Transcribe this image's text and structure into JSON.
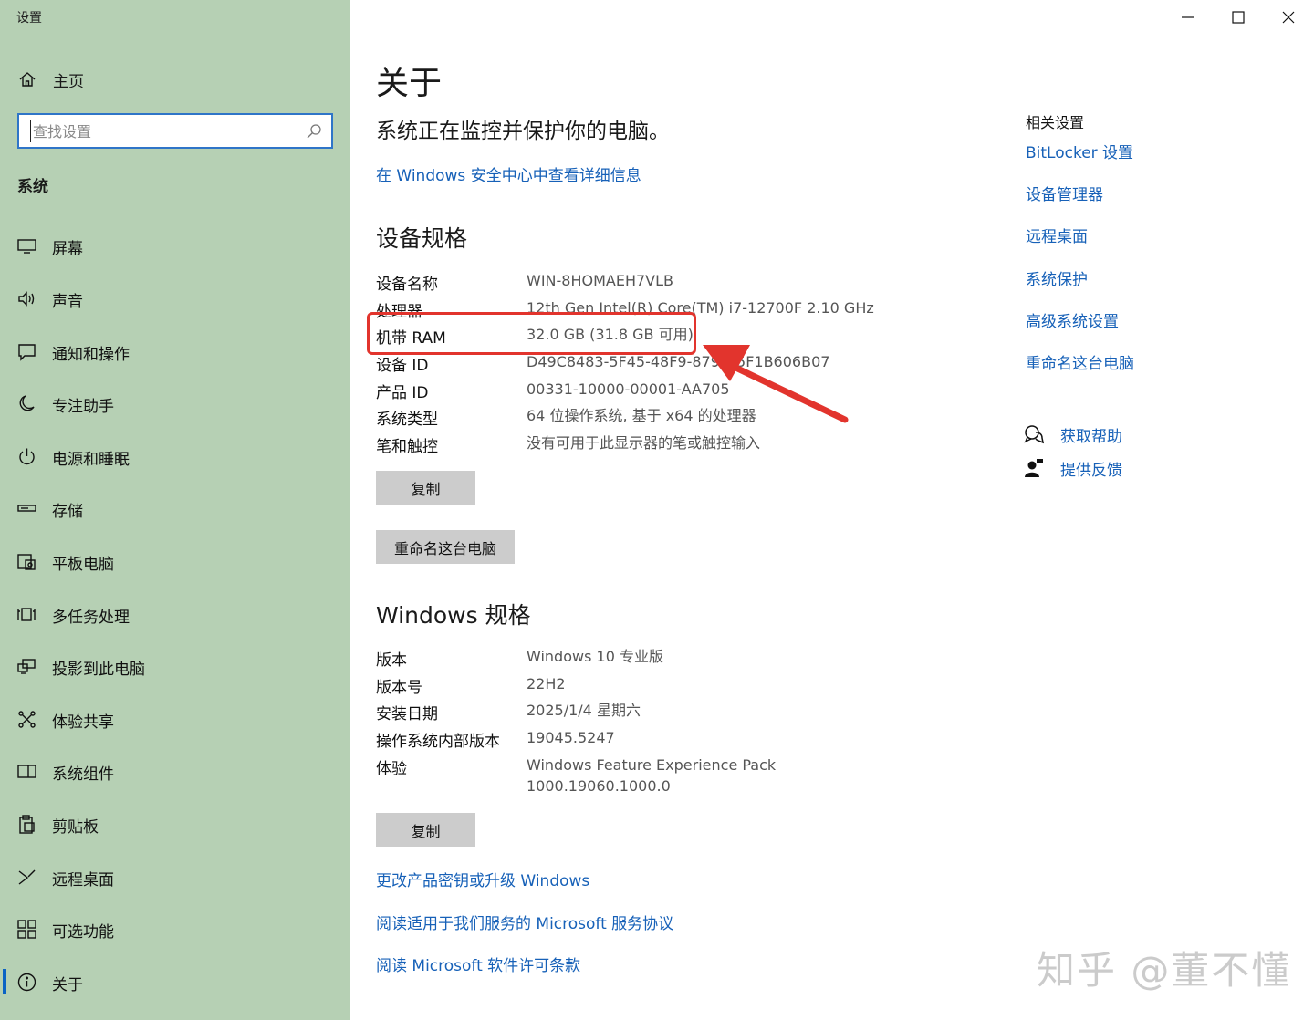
{
  "app_title": "设置",
  "window_controls": {
    "minimize": "minimize",
    "maximize": "maximize",
    "close": "close"
  },
  "sidebar": {
    "home_label": "主页",
    "search_placeholder": "查找设置",
    "section_title": "系统",
    "items": [
      {
        "label": "屏幕",
        "icon": "monitor-icon"
      },
      {
        "label": "声音",
        "icon": "speaker-icon"
      },
      {
        "label": "通知和操作",
        "icon": "notification-icon"
      },
      {
        "label": "专注助手",
        "icon": "moon-icon"
      },
      {
        "label": "电源和睡眠",
        "icon": "power-icon"
      },
      {
        "label": "存储",
        "icon": "storage-icon"
      },
      {
        "label": "平板电脑",
        "icon": "tablet-icon"
      },
      {
        "label": "多任务处理",
        "icon": "multitask-icon"
      },
      {
        "label": "投影到此电脑",
        "icon": "project-icon"
      },
      {
        "label": "体验共享",
        "icon": "share-icon"
      },
      {
        "label": "系统组件",
        "icon": "components-icon"
      },
      {
        "label": "剪贴板",
        "icon": "clipboard-icon"
      },
      {
        "label": "远程桌面",
        "icon": "remote-icon"
      },
      {
        "label": "可选功能",
        "icon": "apps-icon"
      },
      {
        "label": "关于",
        "icon": "info-icon",
        "active": true
      }
    ]
  },
  "main": {
    "title": "关于",
    "protect_message": "系统正在监控并保护你的电脑。",
    "security_link": "在 Windows 安全中心中查看详细信息",
    "device_spec": {
      "heading": "设备规格",
      "rows": [
        {
          "key": "设备名称",
          "value": "WIN-8HOMAEH7VLB"
        },
        {
          "key": "处理器",
          "value": "12th Gen Intel(R) Core(TM) i7-12700F   2.10 GHz"
        },
        {
          "key": "机带 RAM",
          "value": "32.0 GB (31.8 GB 可用)"
        },
        {
          "key": "设备 ID",
          "value": "D49C8483-5F45-48F9-879D-5F1B606B07"
        },
        {
          "key": "产品 ID",
          "value": "00331-10000-00001-AA705"
        },
        {
          "key": "系统类型",
          "value": "64 位操作系统, 基于 x64 的处理器"
        },
        {
          "key": "笔和触控",
          "value": "没有可用于此显示器的笔或触控输入"
        }
      ],
      "copy_button": "复制",
      "rename_button": "重命名这台电脑"
    },
    "windows_spec": {
      "heading": "Windows 规格",
      "rows": [
        {
          "key": "版本",
          "value": "Windows 10 专业版"
        },
        {
          "key": "版本号",
          "value": "22H2"
        },
        {
          "key": "安装日期",
          "value": "2025/1/4 星期六"
        },
        {
          "key": "操作系统内部版本",
          "value": "19045.5247"
        },
        {
          "key": "体验",
          "value": "Windows Feature Experience Pack",
          "value2": "1000.19060.1000.0"
        }
      ],
      "copy_button": "复制"
    },
    "links": {
      "product_key": "更改产品密钥或升级 Windows",
      "service_agreement": "阅读适用于我们服务的 Microsoft 服务协议",
      "license": "阅读 Microsoft 软件许可条款"
    }
  },
  "related": {
    "title": "相关设置",
    "links": [
      "BitLocker 设置",
      "设备管理器",
      "远程桌面",
      "系统保护",
      "高级系统设置",
      "重命名这台电脑"
    ],
    "help_label": "获取帮助",
    "feedback_label": "提供反馈"
  },
  "annotation": {
    "color": "#e2342d"
  },
  "watermark": "知乎 @董不懂",
  "colors": {
    "sidebar_bg": "#b6d0b4",
    "link": "#1761b8",
    "button_bg": "#cccccc",
    "search_border": "#2f75c8"
  }
}
